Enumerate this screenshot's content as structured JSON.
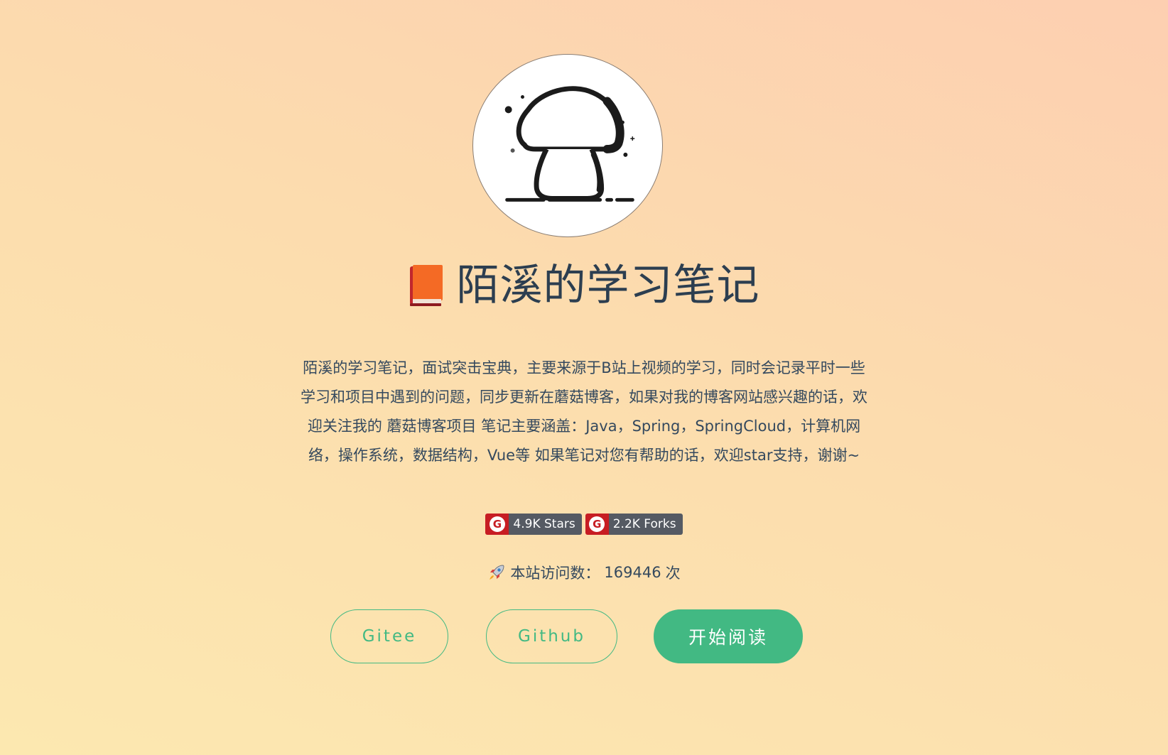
{
  "logo": {
    "icon": "mushroom-logo-icon",
    "stroke_color": "#1b1b1b"
  },
  "title": {
    "icon": "closed-book-icon",
    "text": "陌溪的学习笔记"
  },
  "description": "陌溪的学习笔记，面试突击宝典，主要来源于B站上视频的学习，同时会记录平时一些学习和项目中遇到的问题，同步更新在蘑菇博客，如果对我的博客网站感兴趣的话，欢迎关注我的 蘑菇博客项目 笔记主要涵盖：Java，Spring，SpringCloud，计算机网络，操作系统，数据结构，Vue等 如果笔记对您有帮助的话，欢迎star支持，谢谢~",
  "badges": [
    {
      "icon": "gitee-icon",
      "label": "4.9K Stars"
    },
    {
      "icon": "gitee-icon",
      "label": "2.2K Forks"
    }
  ],
  "visits": {
    "icon": "rocket-icon",
    "label": "本站访问数：",
    "count": "169446",
    "unit": "次"
  },
  "buttons": {
    "gitee": "Gitee",
    "github": "Github",
    "start": "开始阅读"
  },
  "colors": {
    "accent": "#42b983",
    "gitee_red": "#c71d23",
    "badge_dark": "#555a63",
    "text": "#34495e"
  }
}
